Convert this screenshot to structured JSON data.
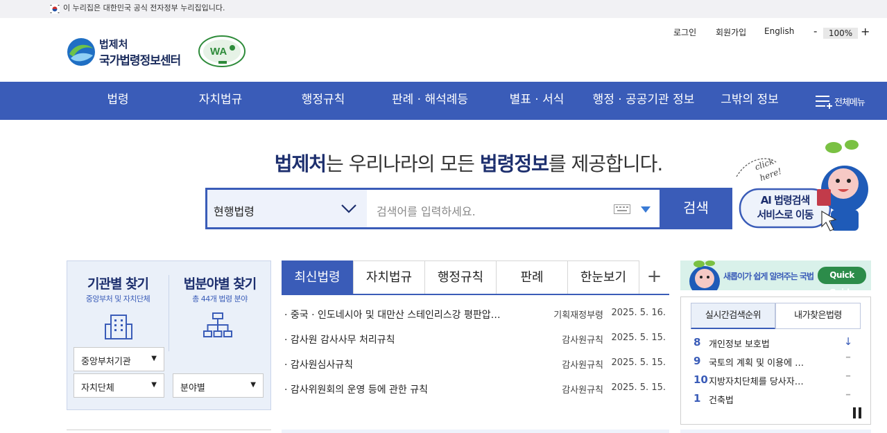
{
  "gov_notice": "이 누리집은 대한민국 공식 전자정부 누리집입니다.",
  "logo": {
    "line1": "법제처",
    "line2": "국가법령정보센터"
  },
  "util": {
    "login": "로그인",
    "join": "회원가입",
    "english": "English",
    "zoom": "100%",
    "zoom_minus": "-",
    "zoom_plus": "+"
  },
  "gnb": {
    "items": [
      "법령",
      "자치법규",
      "행정규칙",
      "판례 · 해석례등",
      "별표 · 서식",
      "행정 · 공공기관 정보",
      "그밖의 정보"
    ],
    "all_menu": "전체메뉴"
  },
  "hero": {
    "b1": "법제처",
    "t1": "는 우리나라의 모든 ",
    "b2": "법령정보",
    "t2": "를 제공합니다."
  },
  "search": {
    "select": "현행법령",
    "placeholder": "검색어를 입력하세요.",
    "button": "검색"
  },
  "ai": {
    "click": "click",
    "here": "here!",
    "line1": "AI 법령검색",
    "line2": "서비스로 이동"
  },
  "finder": {
    "org": {
      "title": "기관별 찾기",
      "sub": "중앙부처 및 자치단체",
      "select1": "중앙부처기관",
      "select2": "자치단체"
    },
    "field": {
      "title": "법분야별 찾기",
      "sub": "총 44개 법령 분야",
      "select1": "분야별"
    }
  },
  "tabs": [
    "최신법령",
    "자치법규",
    "행정규칙",
    "판례",
    "한눈보기"
  ],
  "tab_plus": "+",
  "news": [
    {
      "title": "· 중국 · 인도네시아 및 대만산 스테인리스강 평판압…",
      "org": "기획재정부령",
      "date": "2025. 5. 16."
    },
    {
      "title": "· 감사원 감사사무 처리규칙",
      "org": "감사원규칙",
      "date": "2025. 5. 15."
    },
    {
      "title": "· 감사원심사규칙",
      "org": "감사원규칙",
      "date": "2025. 5. 15."
    },
    {
      "title": "· 감사위원회의 운영 등에 관한 규칙",
      "org": "감사원규칙",
      "date": "2025. 5. 15."
    }
  ],
  "quick_guide": {
    "text": "새롭이가 쉽게 알려주는 국법",
    "button": "Quick Guide"
  },
  "rank": {
    "tabs": [
      "실시간검색순위",
      "내가찾은법령"
    ],
    "rows": [
      {
        "num": "8",
        "keyword": "개인정보 보호법",
        "status": "↓"
      },
      {
        "num": "9",
        "keyword": "국토의 계획 및 이용에 …",
        "status": "━"
      },
      {
        "num": "10",
        "keyword": "지방자치단체를 당사자…",
        "status": "━"
      },
      {
        "num": "1",
        "keyword": "건축법",
        "status": "━"
      }
    ]
  },
  "colors": {
    "primary": "#3a5cb8",
    "navy": "#1d2f6e",
    "light": "#eaf0f9"
  }
}
